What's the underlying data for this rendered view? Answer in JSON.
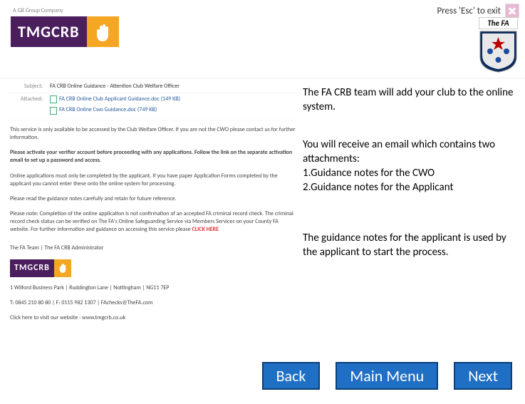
{
  "header": {
    "exit_text": "Press 'Esc' to exit",
    "fa_label": "The FA",
    "tmg_tagline": "A GB Group Company",
    "tmg_logo_text": "TMGCRB"
  },
  "email": {
    "subject_label": "Subject:",
    "subject_value": "FA CRB Online Guidance - Attention Club Welfare Officer",
    "attached_label": "Attached:",
    "attachments": [
      {
        "name": "FA CRB Online Club Applicant Guidance.doc (149 KB)"
      },
      {
        "name": "FA CRB Online Cwo Guidance.doc (749 KB)"
      }
    ],
    "body": {
      "p1": "This service is only available to be accessed by the Club Welfare Officer. If you are not the CWO please contact us for further information.",
      "p2": "Please activate your verifier account before proceeding with any applications. Follow the link on the separate activation email to set up a password and access.",
      "p3": "Online applications must only be completed by the applicant. If you have paper Application Forms completed by the applicant you cannot enter these onto the online system for processing.",
      "p4": "Please read the guidance notes carefully and retain for future reference.",
      "p5_a": "Please note: Completion of the online application is not confirmation of an accepted FA criminal record check. The criminal record check status can be verified on The FA's Online Safeguarding Service via Members Services on your County FA website. For further information and guidance on accessing this service please ",
      "p5_link": "CLICK HERE",
      "sig_team": "The FA Team | The FA CRB Administrator",
      "sig_addr": "1 Wilford Business Park | Ruddington Lane | Nottingham | NG11 7EP",
      "sig_contact": "T: 0845 210 80 80 | F: 0115 982 1307 | FAchecks@TheFA.com",
      "sig_web": "Click here to visit our website · www.tmgcrb.co.uk"
    }
  },
  "callouts": {
    "c1": "The FA CRB team will add your club to the online system.",
    "c2": "You will receive an email which contains two attachments:\n1.Guidance notes for the CWO\n2.Guidance notes for the Applicant",
    "c3": "The guidance notes for the applicant is used by the applicant to start the process."
  },
  "nav": {
    "back": "Back",
    "main": "Main Menu",
    "next": "Next"
  }
}
